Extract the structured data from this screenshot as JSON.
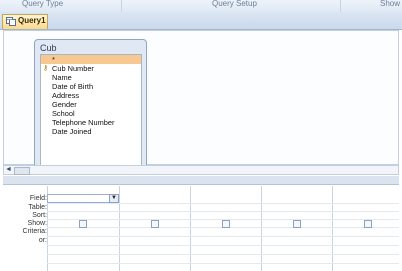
{
  "ribbon": {
    "groups": [
      "Query Type",
      "Query Setup",
      "Show"
    ]
  },
  "document_tab": {
    "label": "Query1",
    "icon": "query-icon"
  },
  "field_list": {
    "title": "Cub",
    "fields": [
      "*",
      "Cub Number",
      "Name",
      "Date of Birth",
      "Address",
      "Gender",
      "School",
      "Telephone Number",
      "Date Joined"
    ],
    "primary_key_field": "Cub Number",
    "selected_row_color": "#f8c891"
  },
  "design_grid": {
    "row_labels": [
      "Field:",
      "Table:",
      "Sort:",
      "Show:",
      "Criteria:",
      "or:"
    ],
    "show_checkbox_count": 5
  },
  "scroll": {
    "left_arrow": "◄",
    "mark": "≡"
  }
}
